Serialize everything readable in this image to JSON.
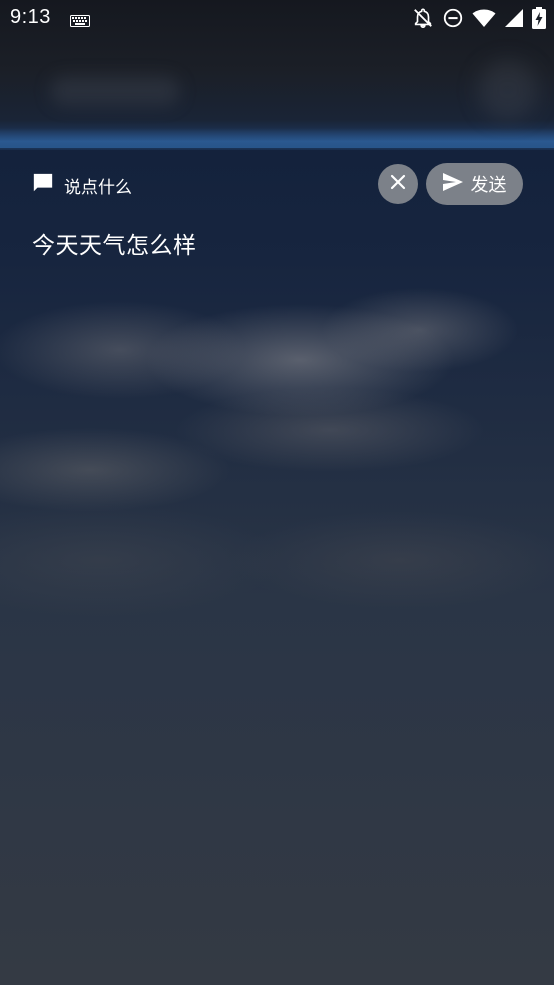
{
  "status_bar": {
    "time": "9:13",
    "icons": [
      "keyboard-icon",
      "notifications-off-icon",
      "do-not-disturb-icon",
      "wifi-icon",
      "cellular-signal-icon",
      "battery-charging-icon"
    ]
  },
  "compose": {
    "prompt_label": "说点什么",
    "prompt_icon": "chat-bubble-icon",
    "clear_icon": "close-icon",
    "send_icon": "send-icon",
    "send_label": "发送",
    "message": "今天天气怎么样"
  },
  "colors": {
    "button_bg": "#7c8189",
    "text": "#ffffff",
    "accent_glow": "#2a5d96"
  }
}
